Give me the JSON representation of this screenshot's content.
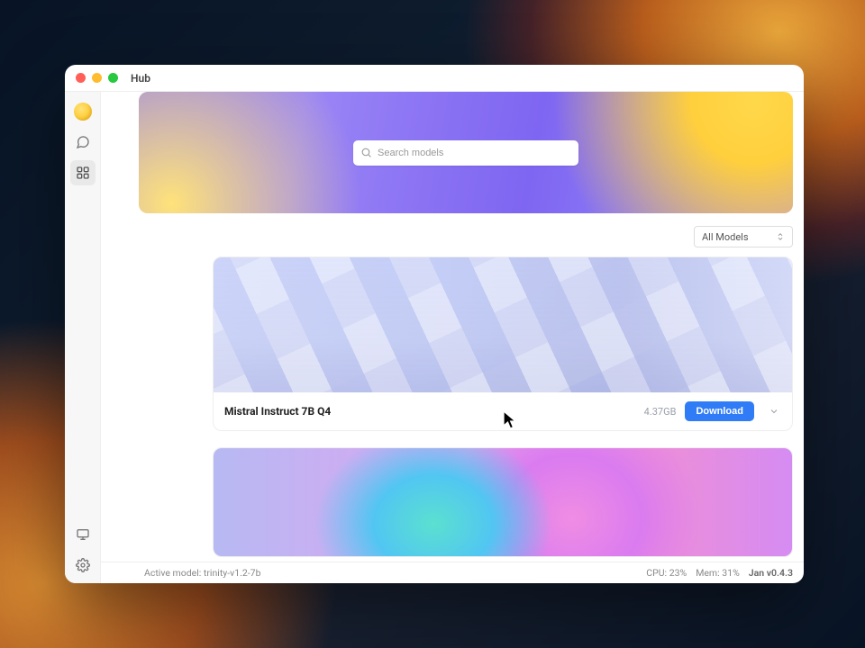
{
  "window": {
    "title": "Hub"
  },
  "sidebar": {
    "logo_name": "app-logo",
    "items": [
      {
        "name": "chat-icon"
      },
      {
        "name": "grid-icon"
      }
    ],
    "bottom": [
      {
        "name": "monitor-icon"
      },
      {
        "name": "gear-icon"
      }
    ]
  },
  "search": {
    "placeholder": "Search models"
  },
  "filter": {
    "label": "All Models"
  },
  "models": [
    {
      "title": "Mistral Instruct 7B Q4",
      "size": "4.37GB",
      "download_label": "Download"
    }
  ],
  "status": {
    "active_model_label": "Active model:",
    "active_model": "trinity-v1.2-7b",
    "cpu_label": "CPU:",
    "cpu": "23%",
    "mem_label": "Mem:",
    "mem": "31%",
    "version": "Jan v0.4.3"
  }
}
